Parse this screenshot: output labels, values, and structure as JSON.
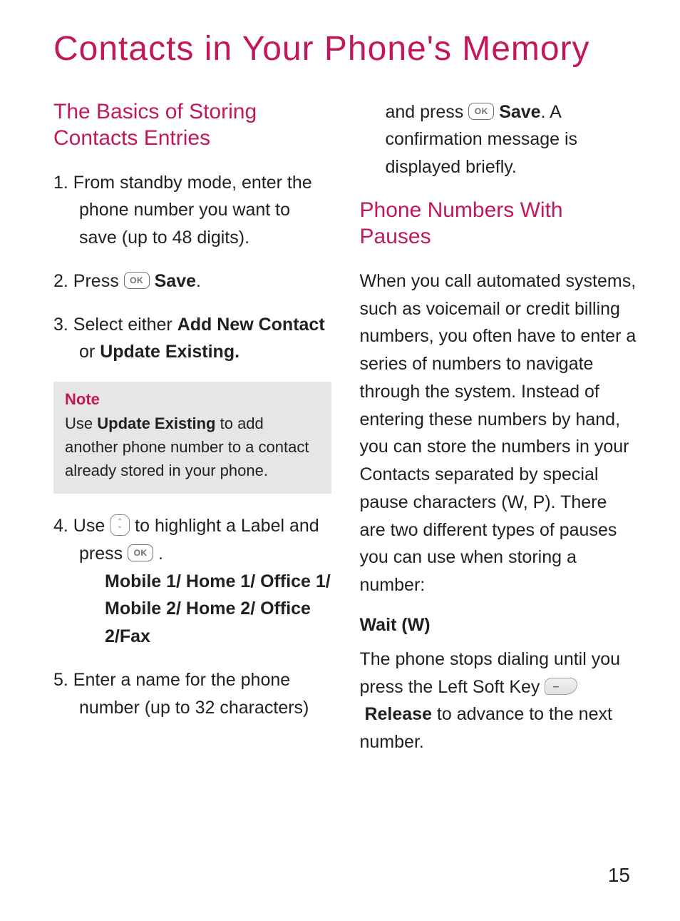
{
  "title": "Contacts in Your Phone's Memory",
  "page_number": "15",
  "left": {
    "section1_title": "The Basics of Storing Contacts Entries",
    "step1_num": "1. ",
    "step1_text": "From standby mode, enter the phone number you want to save (up to 48 digits).",
    "step2_num": "2. ",
    "step2_a": "Press ",
    "ok_label": "OK",
    "step2_b": " ",
    "step2_save": "Save",
    "step2_c": ".",
    "step3_num": "3. ",
    "step3_a": "Select either ",
    "step3_b1": "Add New Contact",
    "step3_b": " or ",
    "step3_b2": "Update Existing.",
    "note_label": "Note",
    "note_a": "Use ",
    "note_b": "Update Existing",
    "note_c": " to add another phone number to a contact already stored in your phone.",
    "step4_num": "4. ",
    "step4_a": "Use ",
    "step4_b": " to highlight a Label and press ",
    "step4_c": " .",
    "labels_line": "Mobile 1/ Home 1/ Office 1/ Mobile 2/ Home 2/ Office 2/Fax",
    "step5_num": "5. ",
    "step5_text": "Enter a name for the phone number (up to 32 characters)"
  },
  "right": {
    "cont_a": "and press ",
    "cont_save": "Save",
    "cont_b": ". A confirmation message is displayed briefly.",
    "section2_title": "Phone Numbers With Pauses",
    "para1": "When you call automated systems, such as voicemail or credit billing numbers, you often have to enter a series of numbers to navigate through the system. Instead of entering these numbers by hand, you can store the numbers in your Contacts separated by special pause characters (W, P). There are two different types of pauses you can use when storing a number:",
    "wait_title": "Wait (W)",
    "wait_a": "The phone stops dialing until you press the Left Soft Key ",
    "wait_release": "Release",
    "wait_b": " to advance to the next number."
  }
}
